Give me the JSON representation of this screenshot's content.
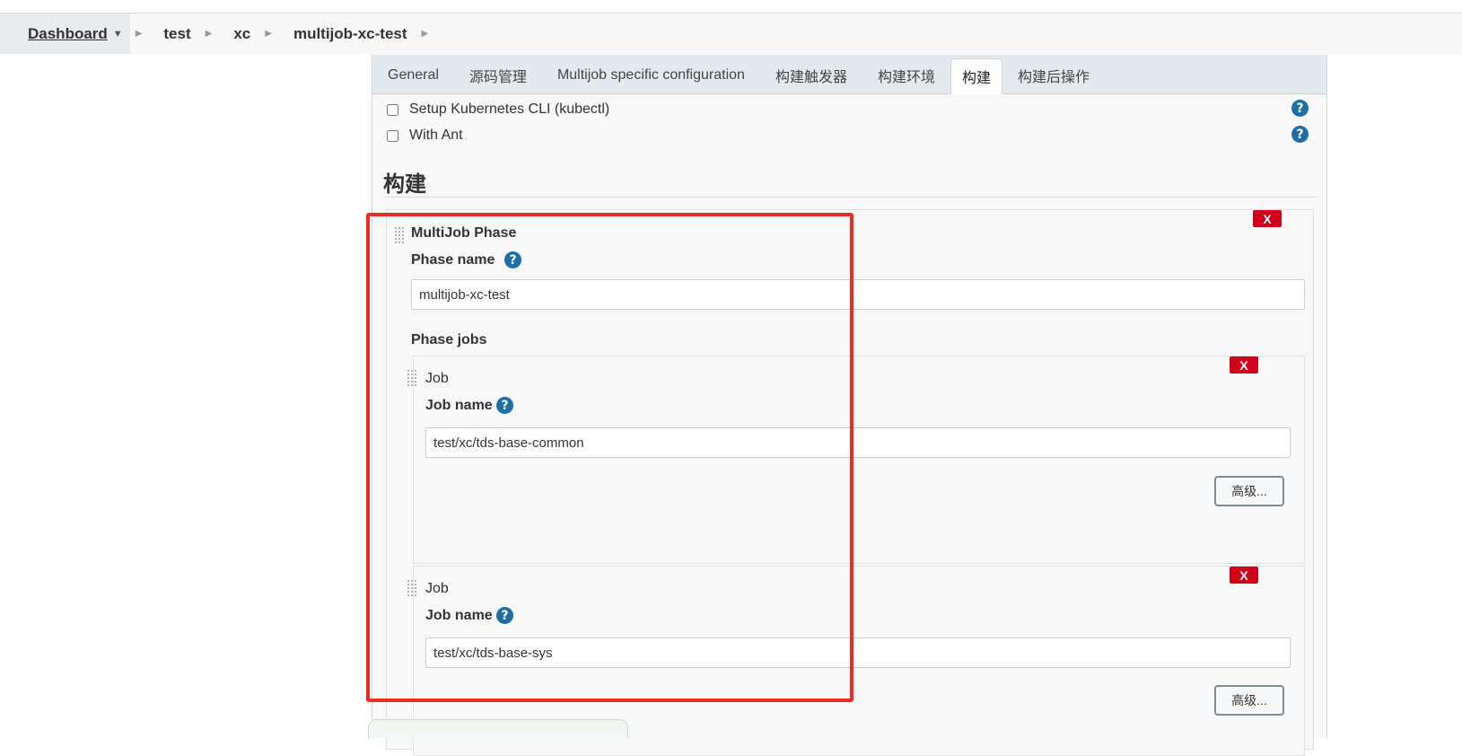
{
  "breadcrumb": {
    "items": [
      "Dashboard",
      "test",
      "xc",
      "multijob-xc-test"
    ]
  },
  "tabs": [
    "General",
    "源码管理",
    "Multijob specific configuration",
    "构建触发器",
    "构建环境",
    "构建",
    "构建后操作"
  ],
  "active_tab": "构建",
  "checkboxes": [
    {
      "label": "Setup Kubernetes CLI (kubectl)",
      "checked": false
    },
    {
      "label": "With Ant",
      "checked": false
    }
  ],
  "section": {
    "title": "构建"
  },
  "phase": {
    "title": "MultiJob Phase",
    "phase_name_label": "Phase name",
    "phase_name_value": "multijob-xc-test",
    "phase_jobs_label": "Phase jobs",
    "delete_label": "X",
    "jobs": [
      {
        "title": "Job",
        "job_name_label": "Job name",
        "job_name_value": "test/xc/tds-base-common",
        "advanced_label": "高级...",
        "delete_label": "X"
      },
      {
        "title": "Job",
        "job_name_label": "Job name",
        "job_name_value": "test/xc/tds-base-sys",
        "advanced_label": "高级...",
        "delete_label": "X"
      }
    ]
  },
  "help_glyph": "?",
  "colors": {
    "accent": "#1d6fa5",
    "delete": "#d0021b",
    "highlight": "#ee2a24"
  }
}
